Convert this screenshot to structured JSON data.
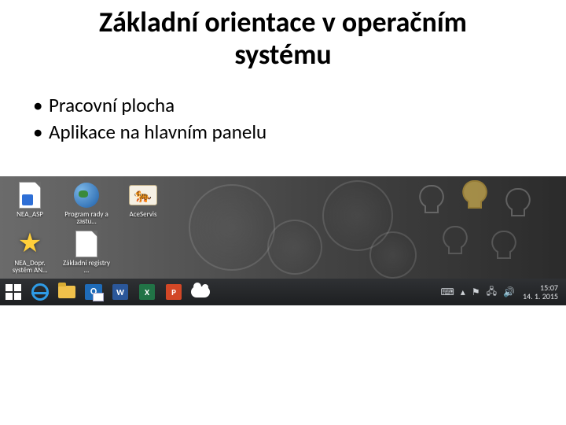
{
  "slide": {
    "title": "Základní orientace v operačním systému",
    "bullets": [
      "Pracovní plocha",
      "Aplikace na hlavním panelu"
    ]
  },
  "desktop": {
    "icons": [
      {
        "id": "nea-asp",
        "label": "NEA_ASP",
        "kind": "page-blue"
      },
      {
        "id": "program",
        "label": "Program rady a zastu…",
        "kind": "earth"
      },
      {
        "id": "aceservis",
        "label": "AceServis",
        "kind": "tiger"
      },
      {
        "id": "nea-dopr",
        "label": "NEA_Dopr. systém AN…",
        "kind": "star"
      },
      {
        "id": "zakladni",
        "label": "Základní registry …",
        "kind": "page-plain"
      }
    ]
  },
  "taskbar": {
    "buttons": [
      {
        "id": "start",
        "name": "Start"
      },
      {
        "id": "ie",
        "name": "Internet Explorer"
      },
      {
        "id": "explorer",
        "name": "Průzkumník souborů"
      },
      {
        "id": "outlook",
        "name": "Outlook",
        "letter": "O"
      },
      {
        "id": "word",
        "name": "Word",
        "letter": "W"
      },
      {
        "id": "excel",
        "name": "Excel",
        "letter": "X"
      },
      {
        "id": "ppt",
        "name": "PowerPoint",
        "letter": "P"
      },
      {
        "id": "onedrive",
        "name": "OneDrive"
      }
    ],
    "tray": {
      "icons": [
        "keyboard",
        "chevron-up",
        "flag",
        "network",
        "volume"
      ],
      "time": "15:07",
      "date": "14. 1. 2015"
    }
  }
}
